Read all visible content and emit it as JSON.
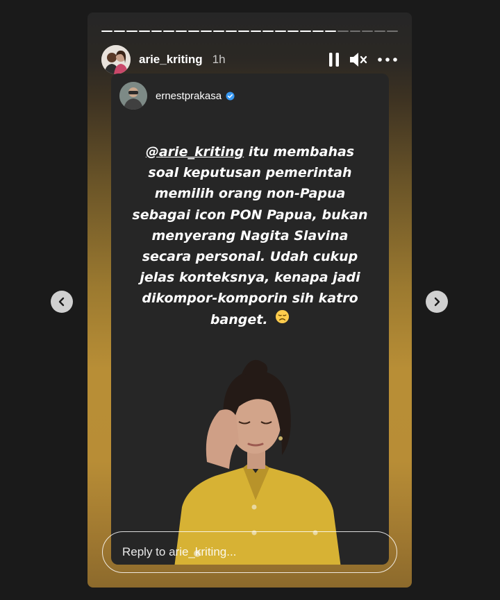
{
  "story": {
    "segments_total": 24,
    "segments_viewed": 19,
    "header": {
      "username": "arie_kriting",
      "time": "1h",
      "icons": [
        "pause-icon",
        "mute-icon",
        "more-icon"
      ]
    },
    "post": {
      "username": "ernestprakasa",
      "verified": true,
      "mention": "@arie_kriting",
      "text": " itu membahas soal keputusan pemerintah memilih orang non-Papua sebagai icon PON Papua, bukan menyerang Nagita Slavina secara personal. Udah cukup jelas konteksnya, kenapa jadi dikompor-komporin sih katro banget."
    },
    "reply": {
      "placeholder": "Reply to arie_kriting..."
    },
    "colors": {
      "background": "#1a1a1a",
      "card": "#262626",
      "gold": "#b88e36",
      "verified": "#3897f0",
      "jacket": "#d7b234"
    }
  },
  "navigation": {
    "icons": [
      "chevron-left-icon",
      "chevron-right-icon"
    ]
  }
}
